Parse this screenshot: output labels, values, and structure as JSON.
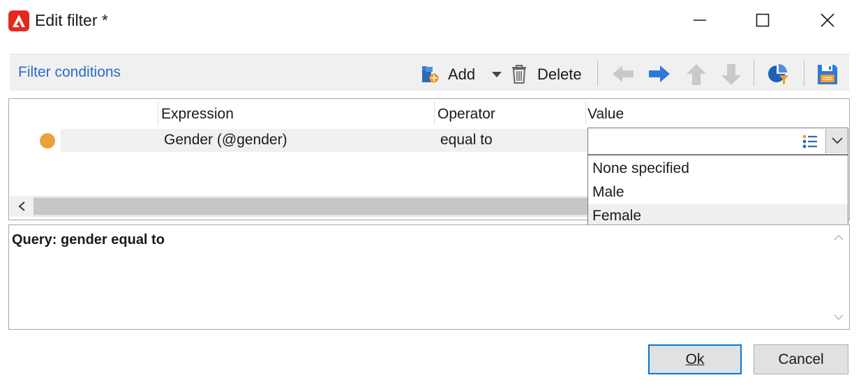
{
  "window": {
    "title": "Edit filter *",
    "icon": "adobe-app-icon",
    "accent_color": "#e5281e"
  },
  "toolbar": {
    "title": "Filter conditions",
    "add_label": "Add",
    "delete_label": "Delete",
    "title_color": "#2a6cc8"
  },
  "grid": {
    "columns": [
      "Expression",
      "Operator",
      "Value"
    ],
    "rows": [
      {
        "status_color": "#e8a23c",
        "expression": "Gender (@gender)",
        "operator": "equal to",
        "value": ""
      }
    ]
  },
  "value_editor": {
    "value": "",
    "options": [
      "None specified",
      "Male",
      "Female"
    ],
    "hovered_option": "Female"
  },
  "query": {
    "text": "Query: gender equal to"
  },
  "footer": {
    "ok_label": "Ok",
    "cancel_label": "Cancel"
  }
}
